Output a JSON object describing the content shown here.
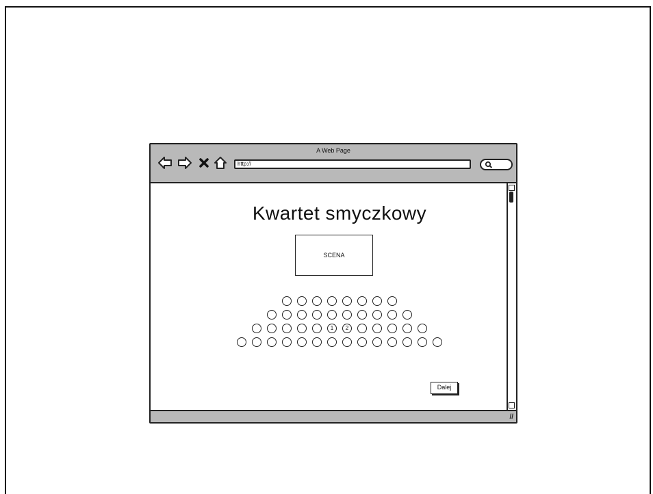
{
  "window": {
    "title": "A Web Page"
  },
  "toolbar": {
    "url": "http://"
  },
  "page": {
    "title": "Kwartet smyczkowy",
    "stage_label": "SCENA"
  },
  "seating": {
    "rows": [
      {
        "seats": [
          "",
          "",
          "",
          "",
          "",
          "",
          "",
          ""
        ]
      },
      {
        "seats": [
          "",
          "",
          "",
          "",
          "",
          "",
          "",
          "",
          "",
          ""
        ]
      },
      {
        "seats": [
          "",
          "",
          "",
          "",
          "",
          "1",
          "2",
          "",
          "",
          "",
          "",
          ""
        ]
      },
      {
        "seats": [
          "",
          "",
          "",
          "",
          "",
          "",
          "",
          "",
          "",
          "",
          "",
          "",
          "",
          ""
        ]
      }
    ]
  },
  "actions": {
    "next_label": "Dalej"
  }
}
